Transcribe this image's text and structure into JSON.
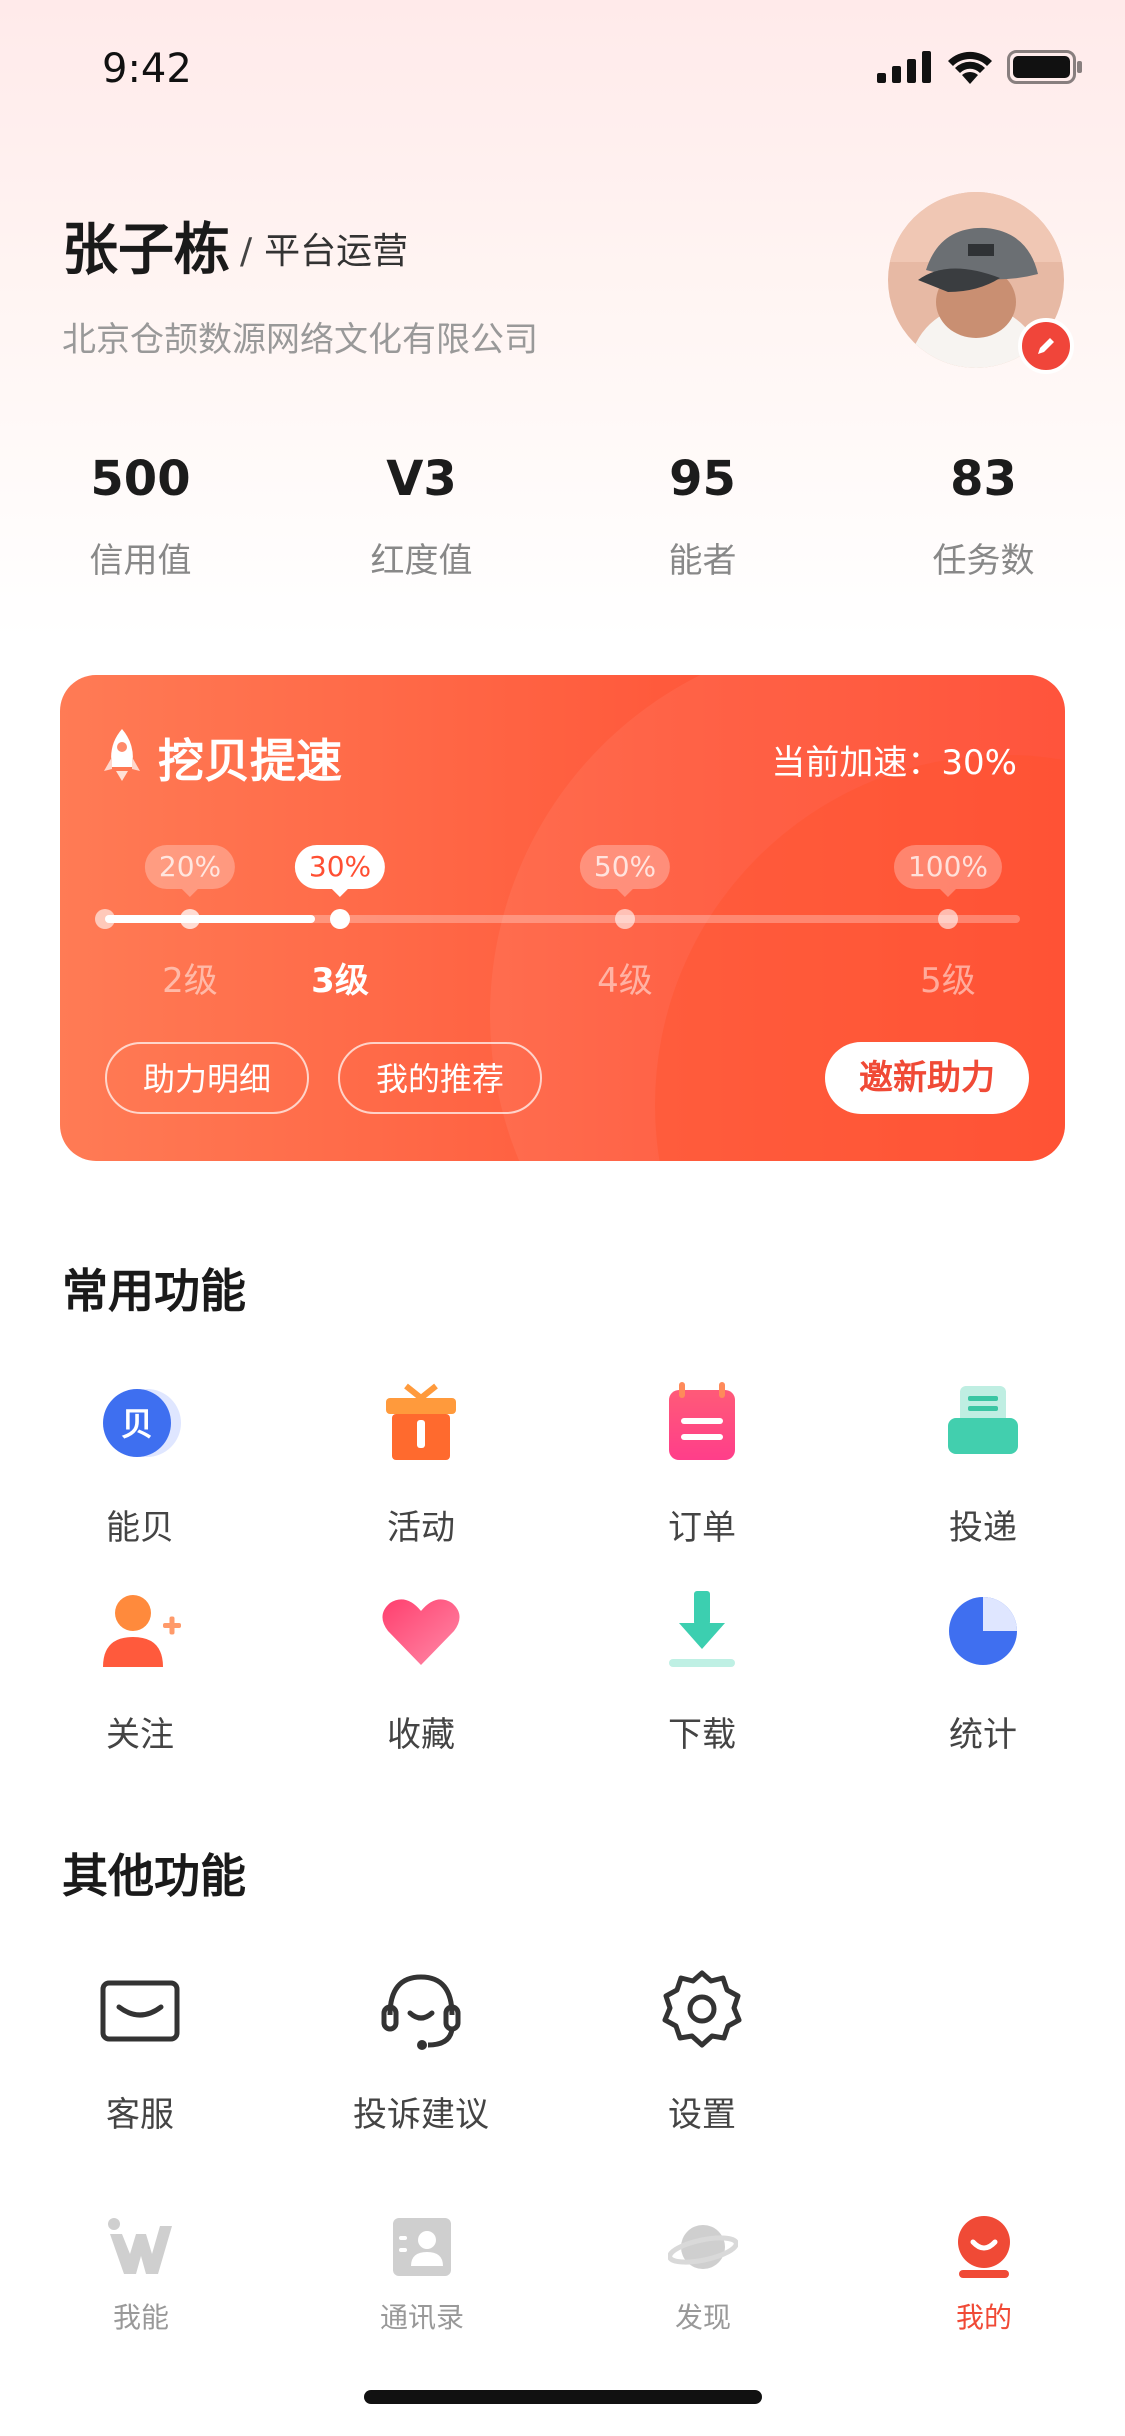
{
  "status_bar": {
    "time": "9:42"
  },
  "profile": {
    "name": "张子栋",
    "role": "平台运营",
    "company": "北京仓颉数源网络文化有限公司"
  },
  "stats": [
    {
      "value": "500",
      "label": "信用值"
    },
    {
      "value": "V3",
      "label": "红度值"
    },
    {
      "value": "95",
      "label": "能者"
    },
    {
      "value": "83",
      "label": "任务数"
    }
  ],
  "speed_card": {
    "title": "挖贝提速",
    "current": "当前加速：30%",
    "levels": [
      {
        "pct": "20%",
        "level": "2级"
      },
      {
        "pct": "30%",
        "level": "3级"
      },
      {
        "pct": "50%",
        "level": "4级"
      },
      {
        "pct": "100%",
        "level": "5级"
      }
    ],
    "active_level_index": 1,
    "progress_fraction": 0.23,
    "buttons": {
      "detail": "助力明细",
      "recommend": "我的推荐",
      "invite": "邀新助力"
    }
  },
  "common": {
    "title": "常用功能",
    "items": [
      {
        "label": "能贝",
        "icon": "coin-icon"
      },
      {
        "label": "活动",
        "icon": "gift-icon"
      },
      {
        "label": "订单",
        "icon": "order-icon"
      },
      {
        "label": "投递",
        "icon": "delivery-icon"
      },
      {
        "label": "关注",
        "icon": "follow-icon"
      },
      {
        "label": "收藏",
        "icon": "heart-icon"
      },
      {
        "label": "下载",
        "icon": "download-icon"
      },
      {
        "label": "统计",
        "icon": "pie-chart-icon"
      }
    ]
  },
  "other": {
    "title": "其他功能",
    "items": [
      {
        "label": "客服",
        "icon": "mail-icon"
      },
      {
        "label": "投诉建议",
        "icon": "headset-icon"
      },
      {
        "label": "设置",
        "icon": "gear-icon"
      }
    ]
  },
  "tabbar": {
    "items": [
      {
        "label": "我能",
        "icon": "w-logo-icon"
      },
      {
        "label": "通讯录",
        "icon": "contacts-icon"
      },
      {
        "label": "发现",
        "icon": "planet-icon"
      },
      {
        "label": "我的",
        "icon": "profile-icon"
      }
    ],
    "active_index": 3
  },
  "colors": {
    "accent": "#f04a36",
    "card_start": "#ff7b55",
    "card_end": "#ff4a30"
  }
}
